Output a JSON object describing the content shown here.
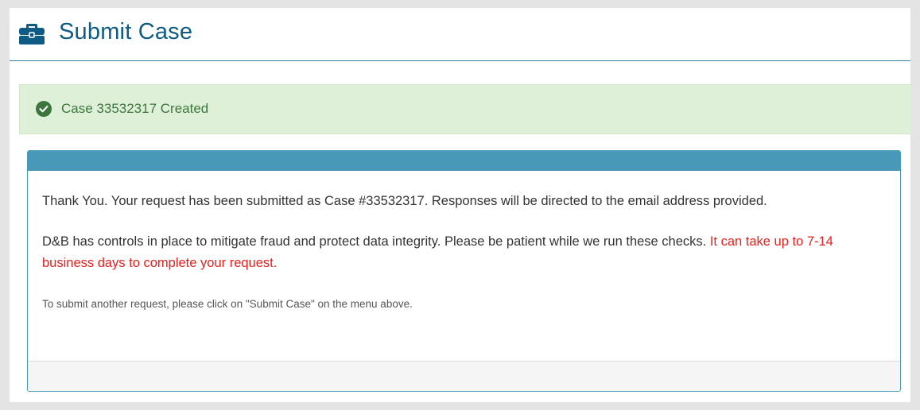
{
  "header": {
    "title": "Submit Case",
    "icon": "briefcase-icon",
    "title_color": "#0e5c85"
  },
  "alert": {
    "icon": "check-circle-icon",
    "message": "Case 33532317 Created",
    "background": "#dff0d8",
    "text_color": "#3c763d"
  },
  "panel": {
    "header_color": "#4799b7",
    "thank_you_text": "Thank You. Your request has been submitted as Case #33532317. Responses will be directed to the email address provided.",
    "controls_text": "D&B has controls in place to mitigate fraud and protect data integrity. Please be patient while we run these checks. ",
    "warning_text": "It can take up to 7-14 business days to complete your request.",
    "warning_color": "#e8201d",
    "another_request_text": "To submit another request, please click on \"Submit Case\" on the menu above."
  }
}
